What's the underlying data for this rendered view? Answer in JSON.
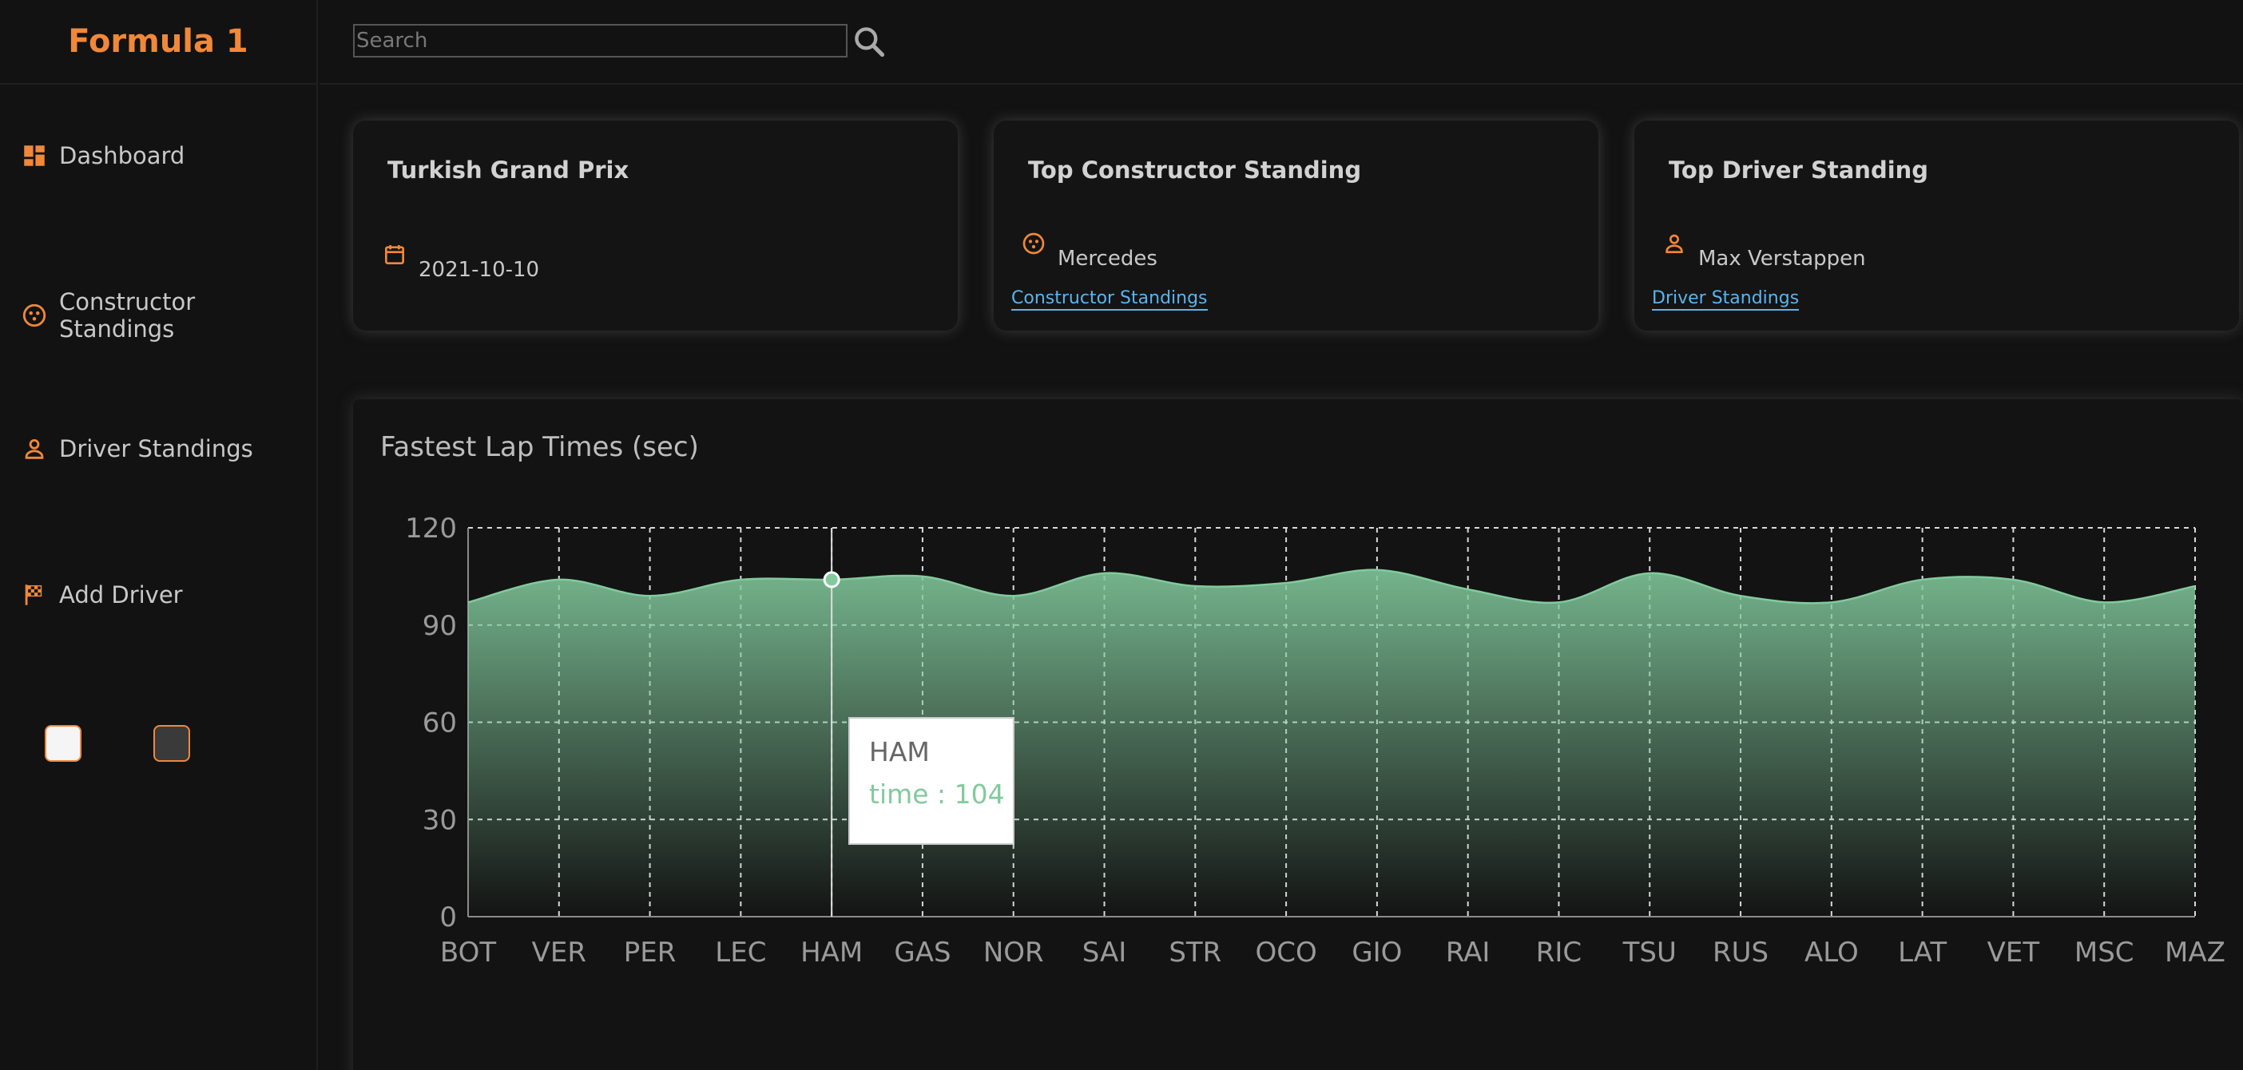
{
  "app": {
    "title": "Formula 1"
  },
  "search": {
    "placeholder": "Search",
    "value": "",
    "icon": "search-icon"
  },
  "sidebar": {
    "items": [
      {
        "label": "Dashboard",
        "icon": "dashboard-icon"
      },
      {
        "label": "Constructor Standings",
        "icon": "constructor-icon"
      },
      {
        "label": "Driver Standings",
        "icon": "person-icon"
      },
      {
        "label": "Add Driver",
        "icon": "checkered-flag-icon"
      }
    ],
    "themes": [
      {
        "name": "light",
        "color": "#f5f5f5"
      },
      {
        "name": "dark",
        "color": "#3a3a3a"
      }
    ]
  },
  "cards": {
    "race": {
      "title": "Turkish Grand Prix",
      "date": "2021-10-10",
      "icon": "calendar-icon"
    },
    "constructor": {
      "title": "Top Constructor Standing",
      "value": "Mercedes",
      "link": "Constructor Standings",
      "icon": "constructor-icon"
    },
    "driver": {
      "title": "Top Driver Standing",
      "value": "Max Verstappen",
      "link": "Driver Standings",
      "icon": "person-icon"
    }
  },
  "colors": {
    "accent": "#f0883a",
    "link": "#5ab4f0",
    "series": "#82ca9d"
  },
  "tooltip": {
    "name": "HAM",
    "label": "time",
    "sep": " : ",
    "value": "104",
    "category_index": 4
  },
  "chart_data": {
    "type": "area",
    "title": "Fastest Lap Times (sec)",
    "categories": [
      "BOT",
      "VER",
      "PER",
      "LEC",
      "HAM",
      "GAS",
      "NOR",
      "SAI",
      "STR",
      "OCO",
      "GIO",
      "RAI",
      "RIC",
      "TSU",
      "RUS",
      "ALO",
      "LAT",
      "VET",
      "MSC",
      "MAZ"
    ],
    "series": [
      {
        "name": "time",
        "values": [
          97,
          104,
          99,
          104,
          104,
          105,
          99,
          106,
          102,
          103,
          107,
          101,
          97,
          106,
          99,
          97,
          104,
          104,
          97,
          102
        ]
      }
    ],
    "ylim": [
      0,
      120
    ],
    "yticks": [
      0,
      30,
      60,
      90,
      120
    ],
    "grid": true,
    "legend": "none"
  }
}
